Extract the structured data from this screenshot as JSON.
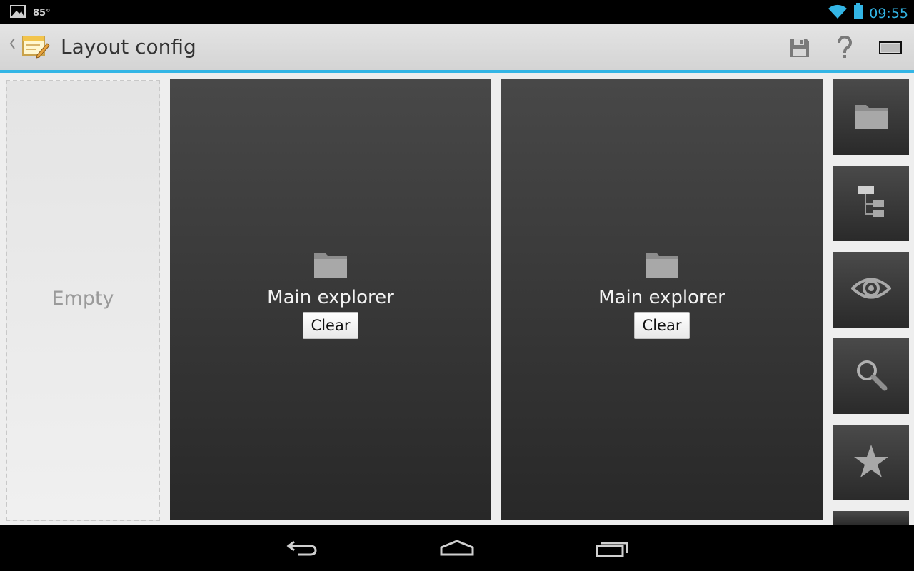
{
  "status_bar": {
    "temperature": "85°",
    "time": "09:55",
    "accent_color": "#33b5e5"
  },
  "action_bar": {
    "title": "Layout config",
    "actions": [
      "save-icon",
      "help-icon",
      "layout-toggle-icon"
    ]
  },
  "empty_slot": {
    "label": "Empty"
  },
  "panels": [
    {
      "label": "Main explorer",
      "button": "Clear",
      "icon": "folder-icon"
    },
    {
      "label": "Main explorer",
      "button": "Clear",
      "icon": "folder-icon"
    }
  ],
  "tiles": [
    "folder-icon",
    "tree-icon",
    "eye-icon",
    "search-icon",
    "star-icon",
    "more-tile"
  ],
  "nav_bar": [
    "back-icon",
    "home-icon",
    "recents-icon"
  ]
}
